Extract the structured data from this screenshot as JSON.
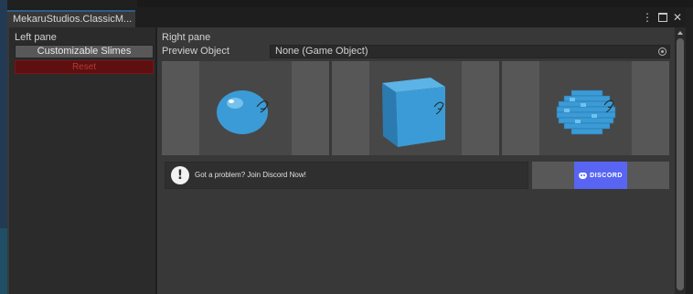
{
  "window": {
    "tab_title": "MekaruStudios.ClassicM...",
    "controls": {
      "menu": "⋮",
      "close": "✕"
    }
  },
  "left_pane": {
    "label": "Left pane",
    "customizable_button": "Customizable Slimes",
    "reset_button": "Reset"
  },
  "right_pane": {
    "label": "Right pane",
    "preview_label": "Preview Object",
    "preview_value": "None (Game Object)",
    "thumbnails": [
      {
        "name": "round slime",
        "icon": "sphere-slime"
      },
      {
        "name": "cube slime",
        "icon": "cube-slime"
      },
      {
        "name": "voxel slime",
        "icon": "voxel-slime"
      }
    ],
    "discord_prompt": "Got a problem? Join Discord Now!",
    "discord_button": "DISCORD",
    "info_glyph": "!"
  },
  "colors": {
    "accent_blue": "#2c5d87",
    "slime_blue": "#3b9bd6",
    "reset_red": "#5e0f0f",
    "discord_blurple": "#5865f2"
  }
}
